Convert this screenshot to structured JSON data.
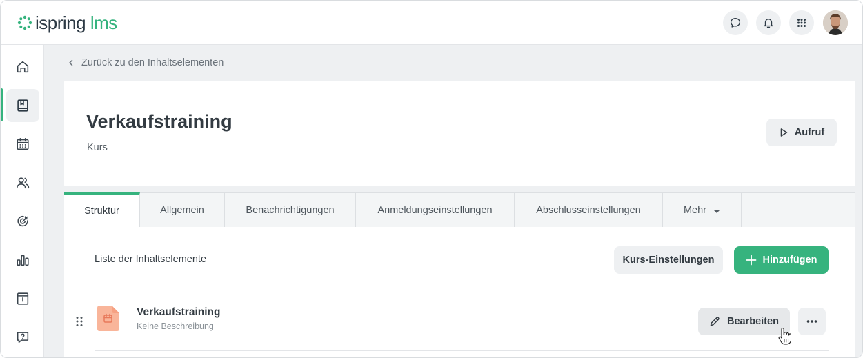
{
  "header": {
    "logo_part1": "ispring",
    "logo_part2": "lms",
    "icons": [
      "chat-icon",
      "bell-icon",
      "apps-grid-icon"
    ],
    "avatar": "user-avatar"
  },
  "sidebar": {
    "items": [
      {
        "icon": "home-icon",
        "active": false
      },
      {
        "icon": "content-book-icon",
        "active": true
      },
      {
        "icon": "calendar-icon",
        "active": false
      },
      {
        "icon": "users-icon",
        "active": false
      },
      {
        "icon": "goals-icon",
        "active": false
      },
      {
        "icon": "reports-icon",
        "active": false
      },
      {
        "icon": "catalog-icon",
        "active": false
      },
      {
        "icon": "help-icon",
        "active": false
      }
    ]
  },
  "back_link": "Zurück zu den Inhaltselementen",
  "course": {
    "title": "Verkaufstraining",
    "type": "Kurs",
    "launch_label": "Aufruf"
  },
  "tabs": [
    {
      "label": "Struktur",
      "active": true
    },
    {
      "label": "Allgemein",
      "active": false
    },
    {
      "label": "Benachrichtigungen",
      "active": false
    },
    {
      "label": "Anmeldungseinstellungen",
      "active": false
    },
    {
      "label": "Abschlusseinstellungen",
      "active": false
    },
    {
      "label": "Mehr",
      "active": false
    }
  ],
  "structure": {
    "list_label": "Liste der Inhaltselemente",
    "settings_label": "Kurs-Einstellungen",
    "add_label": "Hinzufügen",
    "items": [
      {
        "title": "Verkaufstraining",
        "description": "Keine Beschreibung",
        "edit_label": "Bearbeiten"
      }
    ]
  },
  "colors": {
    "accent": "#36b37e",
    "item_icon": "#f9b59a"
  }
}
